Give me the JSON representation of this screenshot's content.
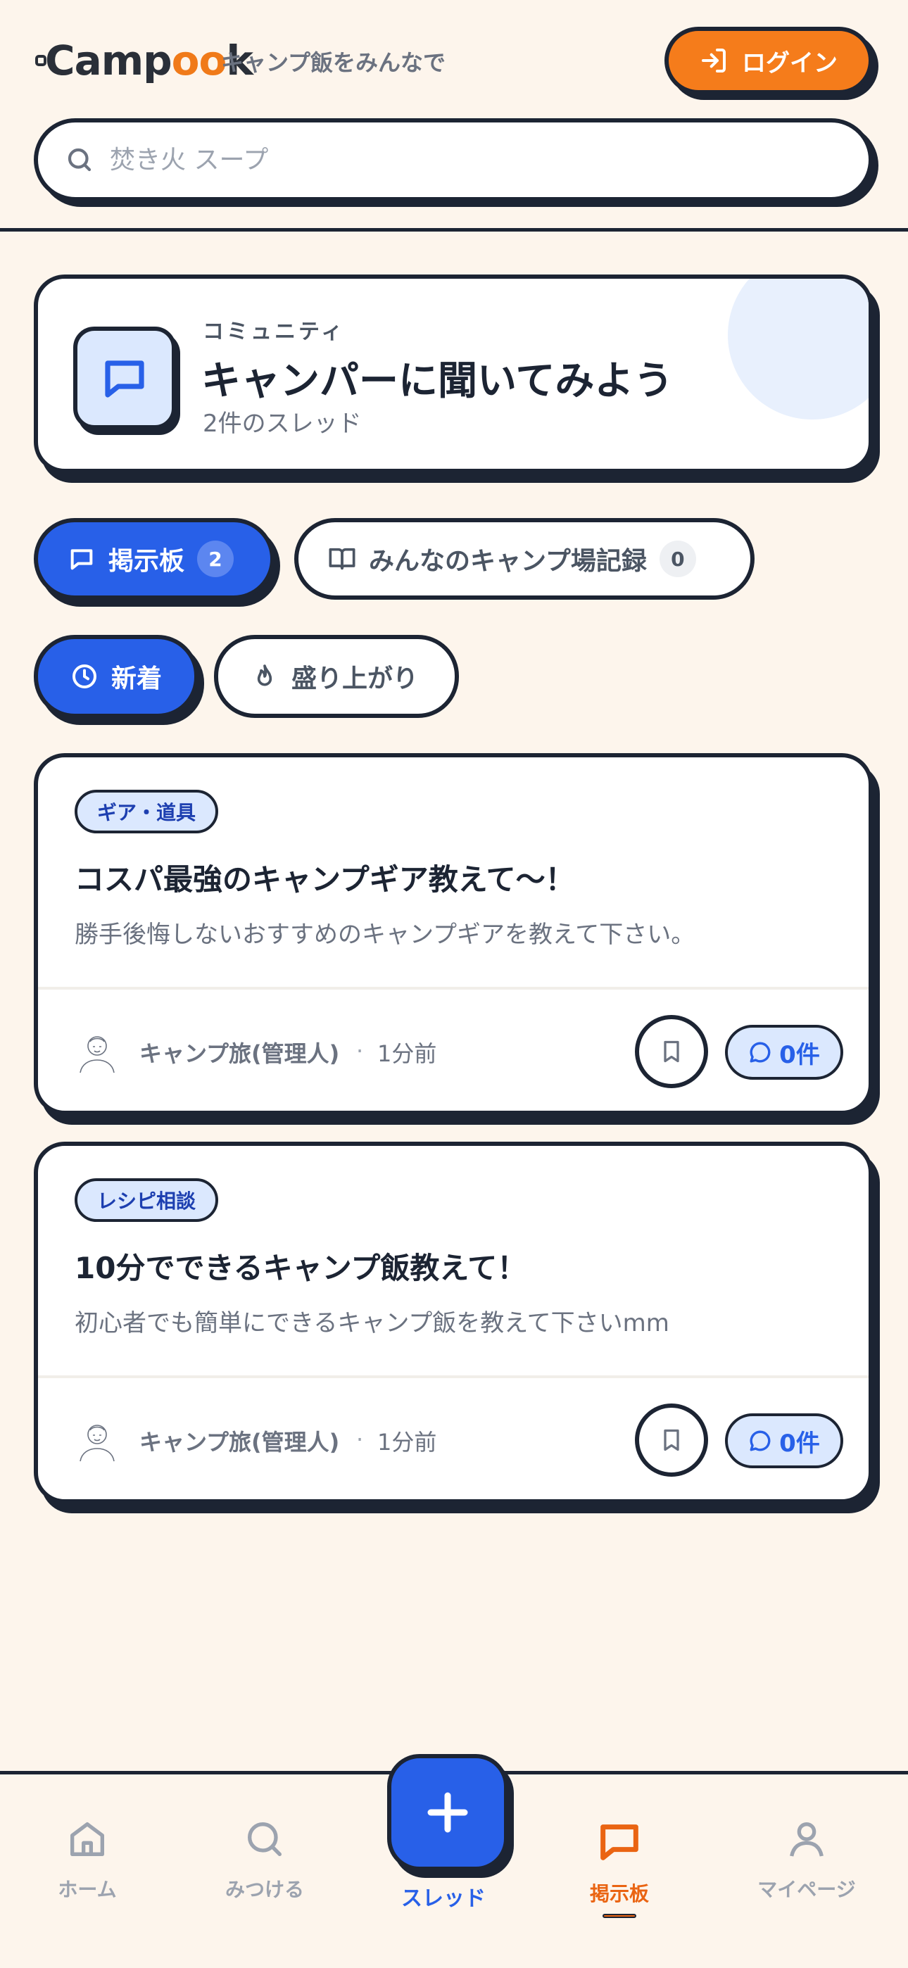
{
  "header": {
    "logo_text_a": "Camp",
    "logo_text_o1": "o",
    "logo_text_o2": "o",
    "logo_text_b": "k",
    "tagline": "キャンプ飯をみんなで",
    "login_label": "ログイン"
  },
  "search": {
    "placeholder": "焚き火 スープ"
  },
  "community": {
    "kicker": "コミュニティ",
    "title": "キャンパーに聞いてみよう",
    "subtitle": "2件のスレッド"
  },
  "tabs": [
    {
      "label": "掲示板",
      "count": "2",
      "active": true
    },
    {
      "label": "みんなのキャンプ場記録",
      "count": "0",
      "active": false
    }
  ],
  "sort": [
    {
      "label": "新着",
      "active": true
    },
    {
      "label": "盛り上がり",
      "active": false
    }
  ],
  "posts": [
    {
      "tag": "ギア・道具",
      "title": "コスパ最強のキャンプギア教えて〜！",
      "body": "勝手後悔しないおすすめのキャンプギアを教えて下さい。",
      "author": "キャンプ旅(管理人)",
      "separator": "·",
      "time": "1分前",
      "comments": "0件"
    },
    {
      "tag": "レシピ相談",
      "title": "10分でできるキャンプ飯教えて！",
      "body": "初心者でも簡単にできるキャンプ飯を教えて下さいmm",
      "author": "キャンプ旅(管理人)",
      "separator": "·",
      "time": "1分前",
      "comments": "0件"
    }
  ],
  "nav": {
    "home": "ホーム",
    "find": "みつける",
    "thread": "スレッド",
    "board": "掲示板",
    "mypage": "マイページ",
    "active": "board"
  },
  "colors": {
    "background": "#fdf5ec",
    "ink": "#1c2433",
    "primary_blue": "#2860e8",
    "accent_orange": "#f57c1b",
    "tag_blue_bg": "#dbe8fe"
  }
}
